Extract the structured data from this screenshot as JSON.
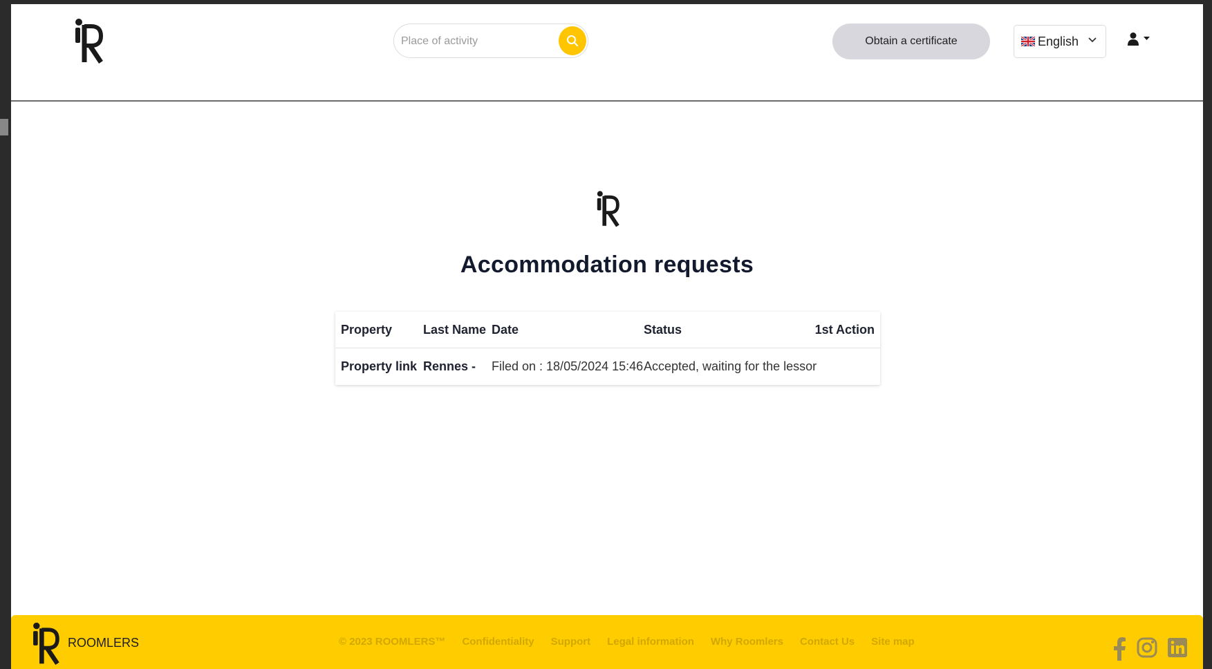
{
  "header": {
    "search": {
      "placeholder": "Place of activity",
      "value": ""
    },
    "certificate_button": "Obtain a certificate",
    "language": {
      "selected": "English"
    }
  },
  "main": {
    "title": "Accommodation requests",
    "table": {
      "columns": [
        "Property",
        "Last Name",
        "Date",
        "Status",
        "1st Action"
      ],
      "rows": [
        {
          "property": "Property link",
          "last_name": "Rennes -",
          "date": "Filed on : 18/05/2024 15:46",
          "status": "Accepted, waiting for the lessor",
          "first_action": ""
        }
      ]
    }
  },
  "footer": {
    "brand": "ROOMLERS",
    "links": [
      "© 2023 ROOMLERS™",
      "Confidentiality",
      "Support",
      "Legal information",
      "Why Roomlers",
      "Contact Us",
      "Site map"
    ],
    "socials": [
      "facebook-icon",
      "instagram-icon",
      "linkedin-icon"
    ]
  },
  "colors": {
    "accent": "#ffcc00",
    "footer_link": "#d2a800",
    "button_grey": "#d7d7dd",
    "title": "#141a2e"
  }
}
